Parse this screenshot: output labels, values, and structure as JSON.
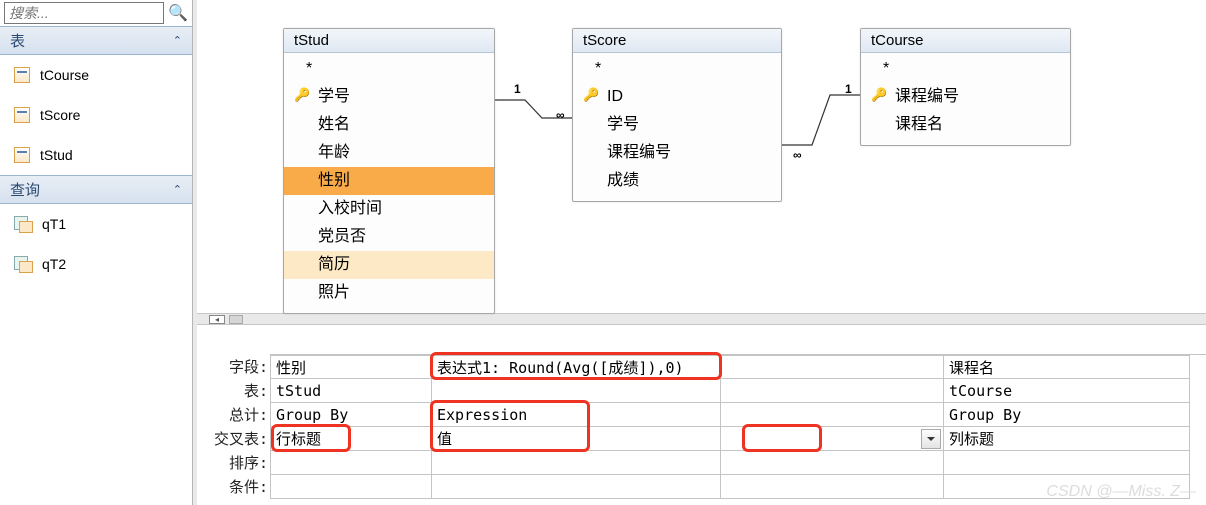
{
  "sidebar": {
    "search_placeholder": "搜索...",
    "groups": [
      {
        "title": "表",
        "items": [
          "tCourse",
          "tScore",
          "tStud"
        ]
      },
      {
        "title": "查询",
        "items": [
          "qT1",
          "qT2"
        ]
      }
    ]
  },
  "diagram": {
    "tables": [
      {
        "name": "tStud",
        "fields": [
          "*",
          "学号",
          "姓名",
          "年龄",
          "性别",
          "入校时间",
          "党员否",
          "简历",
          "照片"
        ],
        "key": 1,
        "selected": 4,
        "hover": 7
      },
      {
        "name": "tScore",
        "fields": [
          "*",
          "ID",
          "学号",
          "课程编号",
          "成绩"
        ],
        "key": 1
      },
      {
        "name": "tCourse",
        "fields": [
          "*",
          "课程编号",
          "课程名"
        ],
        "key": 1
      }
    ],
    "rel_labels": {
      "one": "1",
      "many": "∞"
    }
  },
  "grid": {
    "labels": {
      "field": "字段:",
      "table": "表:",
      "total": "总计:",
      "cross": "交叉表:",
      "sort": "排序:",
      "crit": "条件:"
    },
    "cols": [
      {
        "field": "性别",
        "table": "tStud",
        "total": "Group By",
        "cross": "行标题"
      },
      {
        "field": "表达式1: Round(Avg([成绩]),0)",
        "table": "",
        "total": "Expression",
        "cross": "值"
      },
      {
        "field": "",
        "table": "",
        "total": "",
        "cross": ""
      },
      {
        "field": "课程名",
        "table": "tCourse",
        "total": "Group By",
        "cross": "列标题"
      }
    ]
  },
  "watermark": "CSDN @—Miss. Z—"
}
